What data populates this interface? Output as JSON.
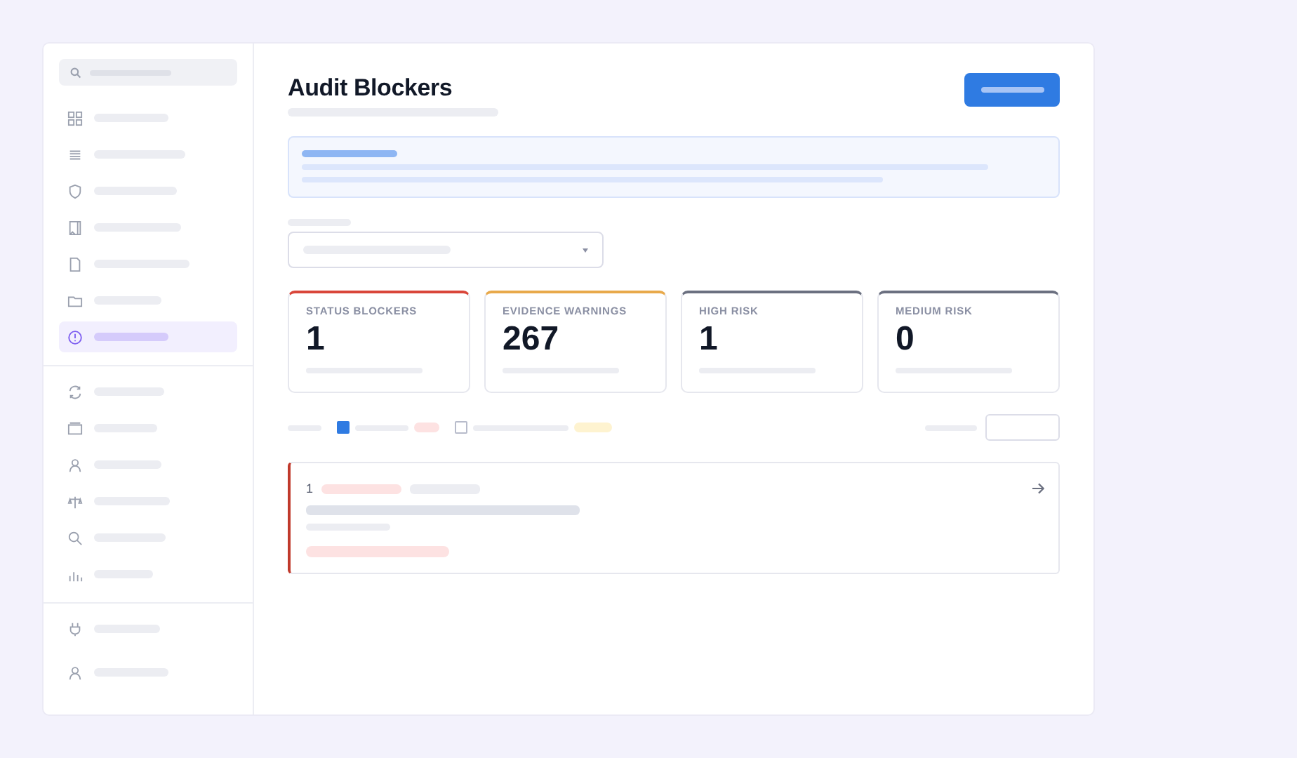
{
  "sidebar": {
    "groups": [
      {
        "items": [
          {
            "selected": false
          },
          {
            "selected": false
          },
          {
            "selected": false
          },
          {
            "selected": false
          },
          {
            "selected": false
          },
          {
            "selected": false
          },
          {
            "selected": true
          }
        ]
      },
      {
        "items": [
          {
            "selected": false
          },
          {
            "selected": false
          },
          {
            "selected": false
          },
          {
            "selected": false
          },
          {
            "selected": false
          },
          {
            "selected": false
          }
        ]
      },
      {
        "items": [
          {
            "selected": false
          },
          {
            "selected": false
          }
        ]
      }
    ]
  },
  "page": {
    "title": "Audit Blockers"
  },
  "stats": [
    {
      "label": "STATUS BLOCKERS",
      "value": "1",
      "color": "#d9463a"
    },
    {
      "label": "EVIDENCE WARNINGS",
      "value": "267",
      "color": "#e8a94a"
    },
    {
      "label": "HIGH RISK",
      "value": "1",
      "color": "#6b7080"
    },
    {
      "label": "MEDIUM RISK",
      "value": "0",
      "color": "#6b7080"
    }
  ],
  "filters": [
    {
      "checked": true,
      "color": "#fde2e2"
    },
    {
      "checked": false,
      "color": "#fef3d0"
    }
  ],
  "issues": [
    {
      "number": "1",
      "color": "#c0392b"
    }
  ]
}
